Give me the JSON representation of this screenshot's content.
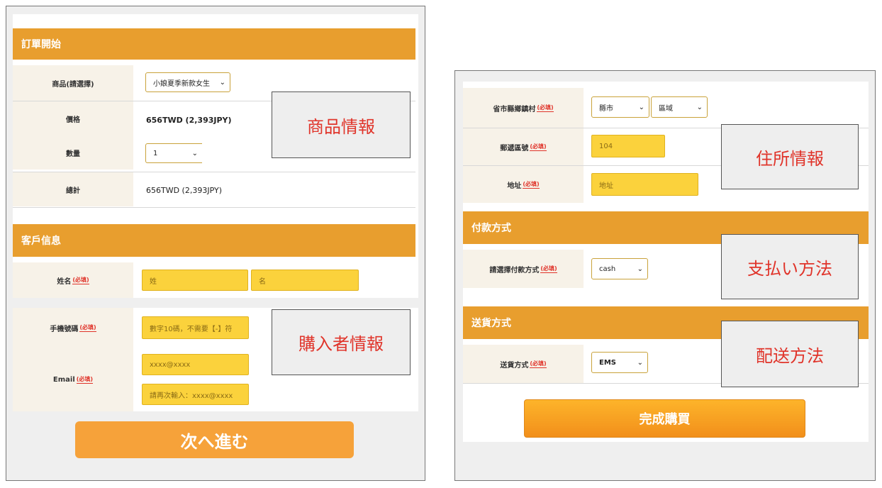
{
  "left": {
    "order_section": {
      "title": "訂單開始",
      "product_label": "商品(請選擇)",
      "product_value": "小娘夏季新款女生",
      "price_label": "價格",
      "price_value": "656TWD (2,393JPY)",
      "quantity_label": "數量",
      "quantity_value": "1",
      "total_label": "總計",
      "total_value": "656TWD (2,393JPY)"
    },
    "customer_section": {
      "title": "客戶信息",
      "name_label": "姓名",
      "surname_placeholder": "姓",
      "given_placeholder": "名",
      "phone_label": "手機號碼",
      "phone_placeholder": "數字10碼，不需要【-】符",
      "email_label": "Email",
      "email_placeholder": "xxxx@xxxx",
      "email_confirm_placeholder": "請再次輸入：xxxx@xxxx"
    },
    "required_tag": "(必填)",
    "annotations": {
      "product_info": "商品情報",
      "buyer_info": "購入者情報"
    },
    "next_button": "次へ進む"
  },
  "right": {
    "address_section": {
      "city_label": "省市縣鄉鎮村",
      "city_value": "縣市",
      "district_value": "區域",
      "zip_label": "郵遞區號",
      "zip_value": "104",
      "address_label": "地址",
      "address_placeholder": "地址"
    },
    "payment_section": {
      "title": "付款方式",
      "method_label": "請選擇付款方式",
      "method_value": "cash"
    },
    "shipping_section": {
      "title": "送貨方式",
      "method_label": "送貨方式",
      "method_value": "EMS"
    },
    "required_tag": "(必填)",
    "annotations": {
      "address_info": "住所情報",
      "payment_method": "支払い方法",
      "delivery_method": "配送方法"
    },
    "complete_button": "完成購買"
  },
  "colors": {
    "section_header": "#e89e2e",
    "input_yellow": "#fbd23c",
    "annotation_text": "#e0342a",
    "next_button": "#f6a23a"
  }
}
